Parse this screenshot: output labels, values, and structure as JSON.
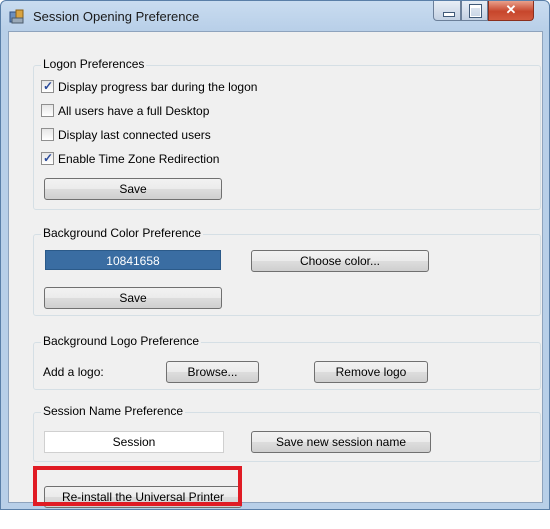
{
  "window": {
    "title": "Session Opening Preference"
  },
  "logon": {
    "group_label": "Logon Preferences",
    "options": [
      {
        "label": "Display progress bar during the logon",
        "checked": true
      },
      {
        "label": "All users have a full Desktop",
        "checked": false
      },
      {
        "label": "Display last connected users",
        "checked": false
      },
      {
        "label": "Enable Time Zone Redirection",
        "checked": true
      }
    ],
    "save_label": "Save"
  },
  "background_color": {
    "group_label": "Background Color Preference",
    "value": "10841658",
    "choose_label": "Choose color...",
    "save_label": "Save",
    "swatch_color": "#3a6da2"
  },
  "background_logo": {
    "group_label": "Background Logo Preference",
    "add_label": "Add a logo:",
    "browse_label": "Browse...",
    "remove_label": "Remove logo"
  },
  "session_name": {
    "group_label": "Session Name Preference",
    "value": "Session",
    "save_label": "Save new session name"
  },
  "reinstall_label": "Re-install the Universal Printer",
  "colors": {
    "highlight": "#e01b24",
    "close_button": "#c7462c"
  }
}
